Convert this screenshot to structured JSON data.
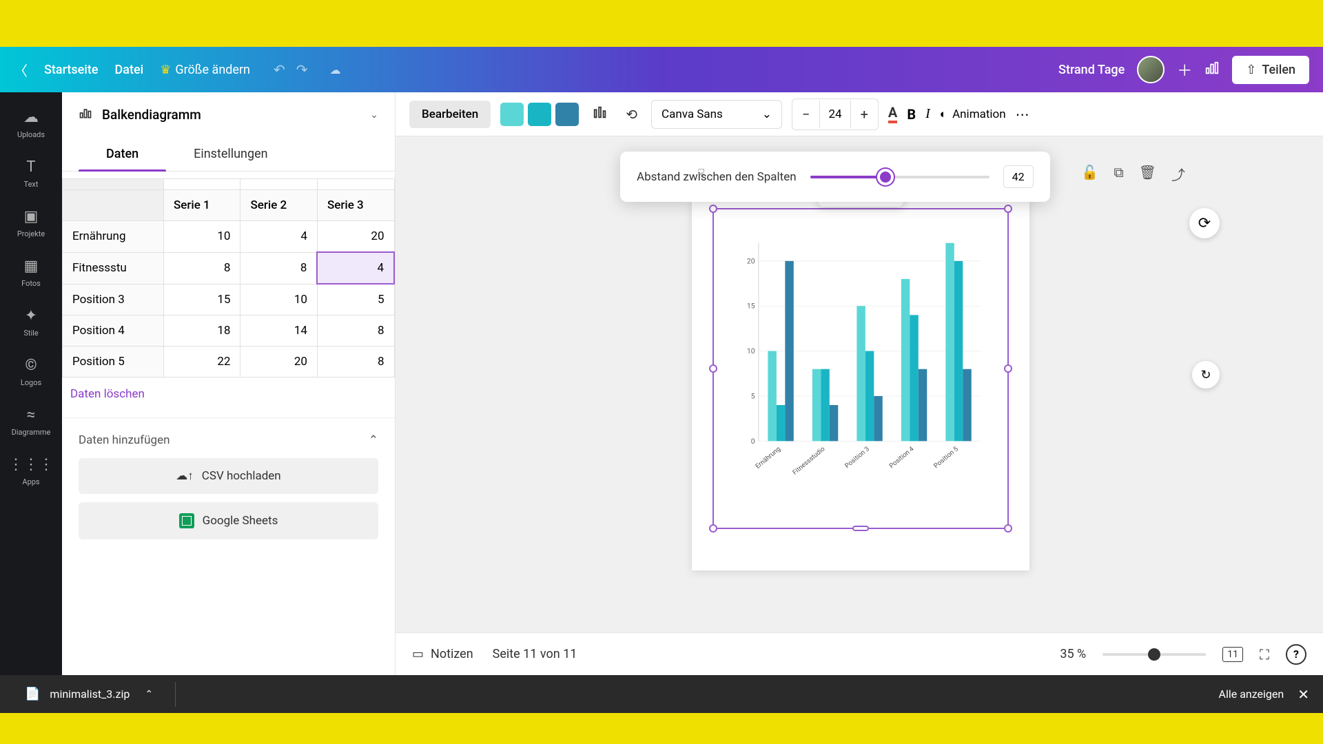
{
  "header": {
    "home": "Startseite",
    "file": "Datei",
    "resize": "Größe ändern",
    "doc_title": "Strand Tage",
    "share": "Teilen"
  },
  "icon_sidebar": [
    {
      "icon": "☁",
      "label": "Uploads"
    },
    {
      "icon": "T",
      "label": "Text"
    },
    {
      "icon": "▣",
      "label": "Projekte"
    },
    {
      "icon": "▦",
      "label": "Fotos"
    },
    {
      "icon": "✦",
      "label": "Stile"
    },
    {
      "icon": "©",
      "label": "Logos"
    },
    {
      "icon": "≈",
      "label": "Diagramme"
    },
    {
      "icon": "⋮⋮⋮",
      "label": "Apps"
    }
  ],
  "chart_type": "Balkendiagramm",
  "tabs": {
    "data": "Daten",
    "settings": "Einstellungen"
  },
  "table": {
    "headers": [
      "",
      "Serie 1",
      "Serie 2",
      "Serie 3"
    ],
    "rows": [
      {
        "label": "Ernährung",
        "values": [
          "10",
          "4",
          "20"
        ]
      },
      {
        "label": "Fitnessstu",
        "values": [
          "8",
          "8",
          "4"
        ]
      },
      {
        "label": "Position 3",
        "values": [
          "15",
          "10",
          "5"
        ]
      },
      {
        "label": "Position 4",
        "values": [
          "18",
          "14",
          "8"
        ]
      },
      {
        "label": "Position 5",
        "values": [
          "22",
          "20",
          "8"
        ]
      }
    ],
    "selected_cell": {
      "row": 1,
      "col": 2
    }
  },
  "clear_data": "Daten löschen",
  "add_data": {
    "header": "Daten hinzufügen",
    "csv": "CSV hochladen",
    "sheets": "Google Sheets"
  },
  "toolbar": {
    "edit": "Bearbeiten",
    "colors": [
      "#5bd6d6",
      "#1ab5c5",
      "#3182a8"
    ],
    "font": "Canva Sans",
    "font_size": "24",
    "animation": "Animation"
  },
  "spacing_popup": {
    "label": "Abstand zwischen den Spalten",
    "value": "42",
    "percent": 42
  },
  "bottom_bar": {
    "notes": "Notizen",
    "page": "Seite 11 von 11",
    "zoom": "35 %",
    "grid_count": "11"
  },
  "download": {
    "filename": "minimalist_3.zip",
    "show_all": "Alle anzeigen"
  },
  "chart_data": {
    "type": "bar",
    "categories": [
      "Ernährung",
      "Fitnessstudio",
      "Position 3",
      "Position 4",
      "Position 5"
    ],
    "series": [
      {
        "name": "Serie 1",
        "values": [
          10,
          8,
          15,
          18,
          22
        ],
        "color": "#5bd6d6"
      },
      {
        "name": "Serie 2",
        "values": [
          4,
          8,
          10,
          14,
          20
        ],
        "color": "#1ab5c5"
      },
      {
        "name": "Serie 3",
        "values": [
          20,
          4,
          5,
          8,
          8
        ],
        "color": "#3182a8"
      }
    ],
    "ylim": [
      0,
      22
    ],
    "yticks": [
      0,
      5,
      10,
      15,
      20
    ],
    "title": "",
    "xlabel": "",
    "ylabel": ""
  }
}
